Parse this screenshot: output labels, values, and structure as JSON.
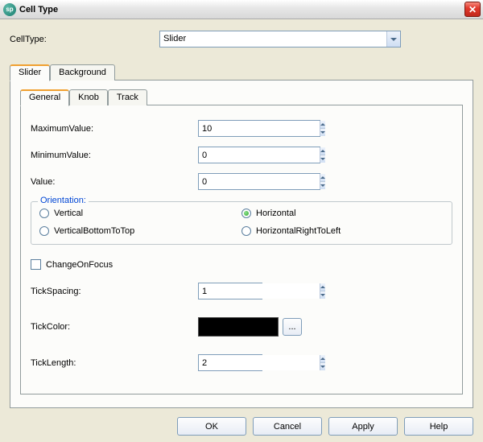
{
  "window": {
    "title": "Cell Type"
  },
  "header": {
    "cellTypeLabel": "CellType:",
    "cellTypeValue": "Slider"
  },
  "outerTabs": {
    "slider": "Slider",
    "background": "Background"
  },
  "innerTabs": {
    "general": "General",
    "knob": "Knob",
    "track": "Track"
  },
  "general": {
    "maximumLabel": "MaximumValue:",
    "maximumValue": "10",
    "minimumLabel": "MinimumValue:",
    "minimumValue": "0",
    "valueLabel": "Value:",
    "valueValue": "0",
    "orientation": {
      "legend": "Orientation:",
      "vertical": "Vertical",
      "verticalBtT": "VerticalBottomToTop",
      "horizontal": "Horizontal",
      "horizontalRtL": "HorizontalRightToLeft",
      "selected": "horizontal"
    },
    "changeOnFocusLabel": "ChangeOnFocus",
    "changeOnFocus": false,
    "tickSpacingLabel": "TickSpacing:",
    "tickSpacingValue": "1",
    "tickColorLabel": "TickColor:",
    "tickColorValue": "#000000",
    "tickLengthLabel": "TickLength:",
    "tickLengthValue": "2"
  },
  "buttons": {
    "ok": "OK",
    "cancel": "Cancel",
    "apply": "Apply",
    "help": "Help",
    "ellipsis": "..."
  }
}
